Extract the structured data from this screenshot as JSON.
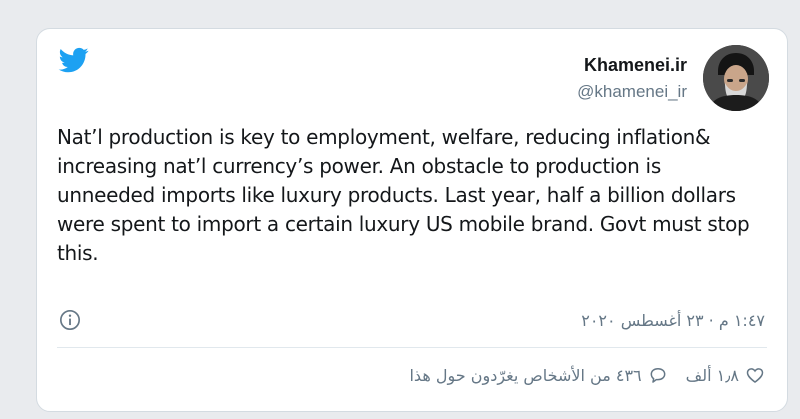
{
  "tweet": {
    "author_name": "Khamenei.ir",
    "author_handle": "@khamenei_ir",
    "text": "Nat’l production is key to employment, welfare, reducing inflation& increasing nat’l currency’s power. An obstacle to production is unneeded imports like luxury products. Last year, half a billion dollars were spent to import a certain luxury US mobile brand. Govt must stop this.",
    "timestamp": "١:٤٧ م · ٢٣ أغسطس ٢٠٢٠",
    "likes_label": "١٫٨ ألف",
    "replies_label": "٤٣٦ من الأشخاص يغرّدون حول هذا"
  },
  "icons": {
    "logo": "twitter-bird-icon",
    "info": "info-icon",
    "like": "heart-icon",
    "reply": "speech-bubble-icon"
  },
  "colors": {
    "brand": "#1da1f2",
    "text": "#14171a",
    "muted": "#657786",
    "border": "#d4dbe1",
    "background": "#e9ebee"
  }
}
